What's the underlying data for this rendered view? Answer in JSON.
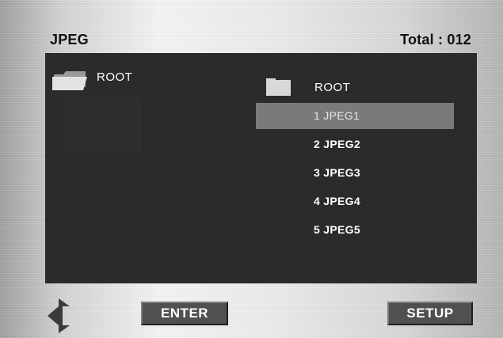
{
  "header": {
    "title": "JPEG",
    "total": "Total : 012"
  },
  "directory": {
    "label": "ROOT",
    "icon": "folder-open-icon"
  },
  "file_list": {
    "root_label": "ROOT",
    "root_icon": "folder-icon",
    "items": [
      {
        "label": "1 JPEG1",
        "selected": true
      },
      {
        "label": "2 JPEG2",
        "selected": false
      },
      {
        "label": "3 JPEG3",
        "selected": false
      },
      {
        "label": "4 JPEG4",
        "selected": false
      },
      {
        "label": "5 JPEG5",
        "selected": false
      }
    ]
  },
  "footer": {
    "nav_icon": "up-down-arrows-icon",
    "enter_label": "ENTER",
    "setup_label": "SETUP"
  },
  "colors": {
    "panel_bg": "#2b2b2b",
    "highlight": "#7a7a7a",
    "button_bg": "#505050",
    "text": "#ffffff"
  }
}
